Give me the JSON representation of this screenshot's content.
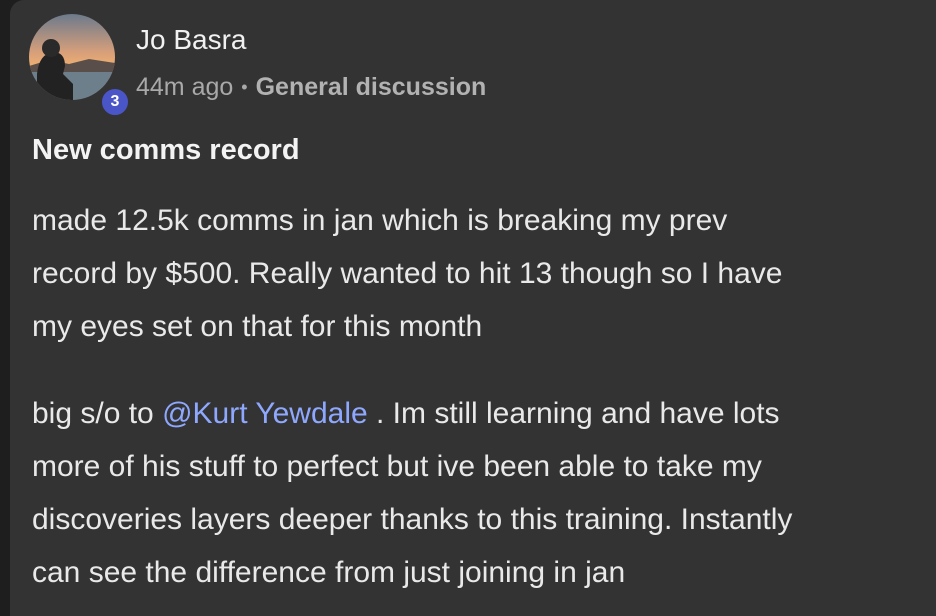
{
  "post": {
    "author": {
      "name": "Jo Basra",
      "level": "3",
      "avatar_icon": "sunset-profile-photo"
    },
    "timestamp": "44m ago",
    "category": "General discussion",
    "title": "New comms record",
    "paragraph1": {
      "lines": [
        "made 12.5k comms in jan which is breaking my prev",
        "record by $500. Really wanted to hit 13 though so I have",
        "my eyes set on that for this month"
      ]
    },
    "paragraph2": {
      "line1_prefix": "big s/o to ",
      "mention": "@Kurt Yewdale",
      "line1_suffix": " . Im still learning and have lots",
      "lines": [
        "more of his stuff to perfect but ive been able to take my",
        "discoveries layers deeper thanks to this training. Instantly",
        "can see the difference from just joining in jan"
      ]
    }
  },
  "colors": {
    "background": "#333333",
    "mention": "#8fa8ff",
    "badge": "#4a56c8"
  }
}
